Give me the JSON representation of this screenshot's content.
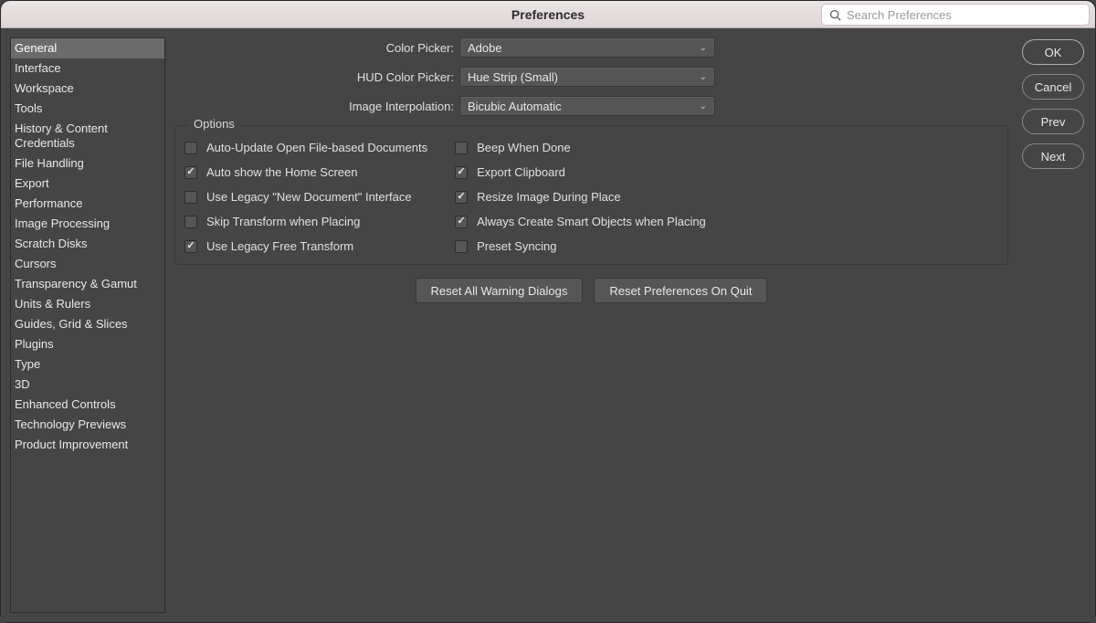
{
  "window": {
    "title": "Preferences",
    "search_placeholder": "Search Preferences"
  },
  "sidebar": {
    "selected_index": 0,
    "items": [
      "General",
      "Interface",
      "Workspace",
      "Tools",
      "History & Content Credentials",
      "File Handling",
      "Export",
      "Performance",
      "Image Processing",
      "Scratch Disks",
      "Cursors",
      "Transparency & Gamut",
      "Units & Rulers",
      "Guides, Grid & Slices",
      "Plugins",
      "Type",
      "3D",
      "Enhanced Controls",
      "Technology Previews",
      "Product Improvement"
    ]
  },
  "dropdowns": {
    "color_picker": {
      "label": "Color Picker:",
      "value": "Adobe"
    },
    "hud_color_picker": {
      "label": "HUD Color Picker:",
      "value": "Hue Strip (Small)"
    },
    "image_interpolation": {
      "label": "Image Interpolation:",
      "value": "Bicubic Automatic"
    }
  },
  "options": {
    "legend": "Options",
    "left": [
      {
        "label": "Auto-Update Open File-based Documents",
        "checked": false
      },
      {
        "label": "Auto show the Home Screen",
        "checked": true
      },
      {
        "label": "Use Legacy \"New Document\" Interface",
        "checked": false
      },
      {
        "label": "Skip Transform when Placing",
        "checked": false
      },
      {
        "label": "Use Legacy Free Transform",
        "checked": true
      }
    ],
    "right": [
      {
        "label": "Beep When Done",
        "checked": false
      },
      {
        "label": "Export Clipboard",
        "checked": true
      },
      {
        "label": "Resize Image During Place",
        "checked": true
      },
      {
        "label": "Always Create Smart Objects when Placing",
        "checked": true
      },
      {
        "label": "Preset Syncing",
        "checked": false
      }
    ]
  },
  "reset_buttons": {
    "warnings": "Reset All Warning Dialogs",
    "on_quit": "Reset Preferences On Quit"
  },
  "side_buttons": {
    "ok": "OK",
    "cancel": "Cancel",
    "prev": "Prev",
    "next": "Next"
  }
}
